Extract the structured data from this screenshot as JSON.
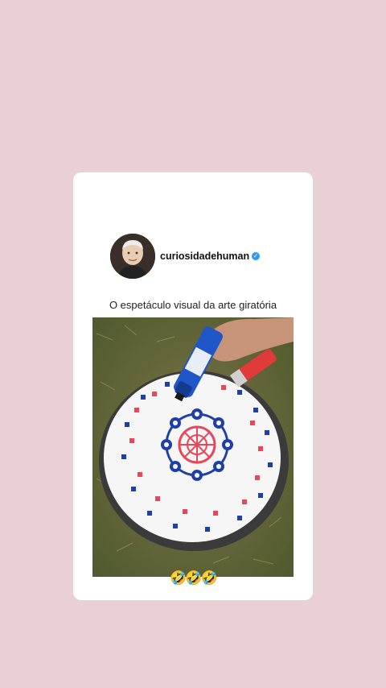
{
  "post": {
    "username": "curiosidadehuman",
    "verified_icon": "check-icon",
    "caption": "O espetáculo visual da arte giratória",
    "emoji": "🤣🤣🤣"
  },
  "colors": {
    "background": "#e8d0d6",
    "card": "#ffffff",
    "verified": "#2d9cf0",
    "marker_blue": "#1f3fa8",
    "marker_red": "#e8475a"
  }
}
